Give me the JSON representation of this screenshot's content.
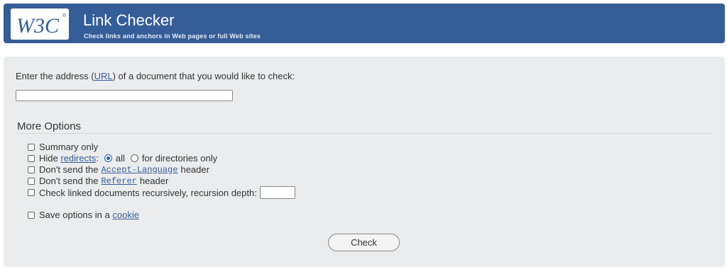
{
  "header": {
    "logo_text": "W3C",
    "title": "Link Checker",
    "subtitle": "Check links and anchors in Web pages or full Web sites",
    "brand_color": "#355d98"
  },
  "form": {
    "prompt_before": "Enter the address (",
    "prompt_link": "URL",
    "prompt_after": ") of a document that you would like to check:",
    "url_value": ""
  },
  "options": {
    "legend": "More Options",
    "summary_only": "Summary only",
    "hide_prefix": "Hide",
    "hide_link": "redirects",
    "hide_colon": ":",
    "radio_all": "all",
    "radio_dirs": "for directories only",
    "accept_prefix": "Don't send the",
    "accept_code": "Accept-Language",
    "accept_suffix": "header",
    "referer_prefix": "Don't send the",
    "referer_code": "Referer",
    "referer_suffix": "header",
    "recursive_label": "Check linked documents recursively, recursion depth:",
    "recursion_depth_value": "",
    "cookie_prefix": "Save options in a",
    "cookie_link": "cookie"
  },
  "submit": {
    "label": "Check"
  }
}
